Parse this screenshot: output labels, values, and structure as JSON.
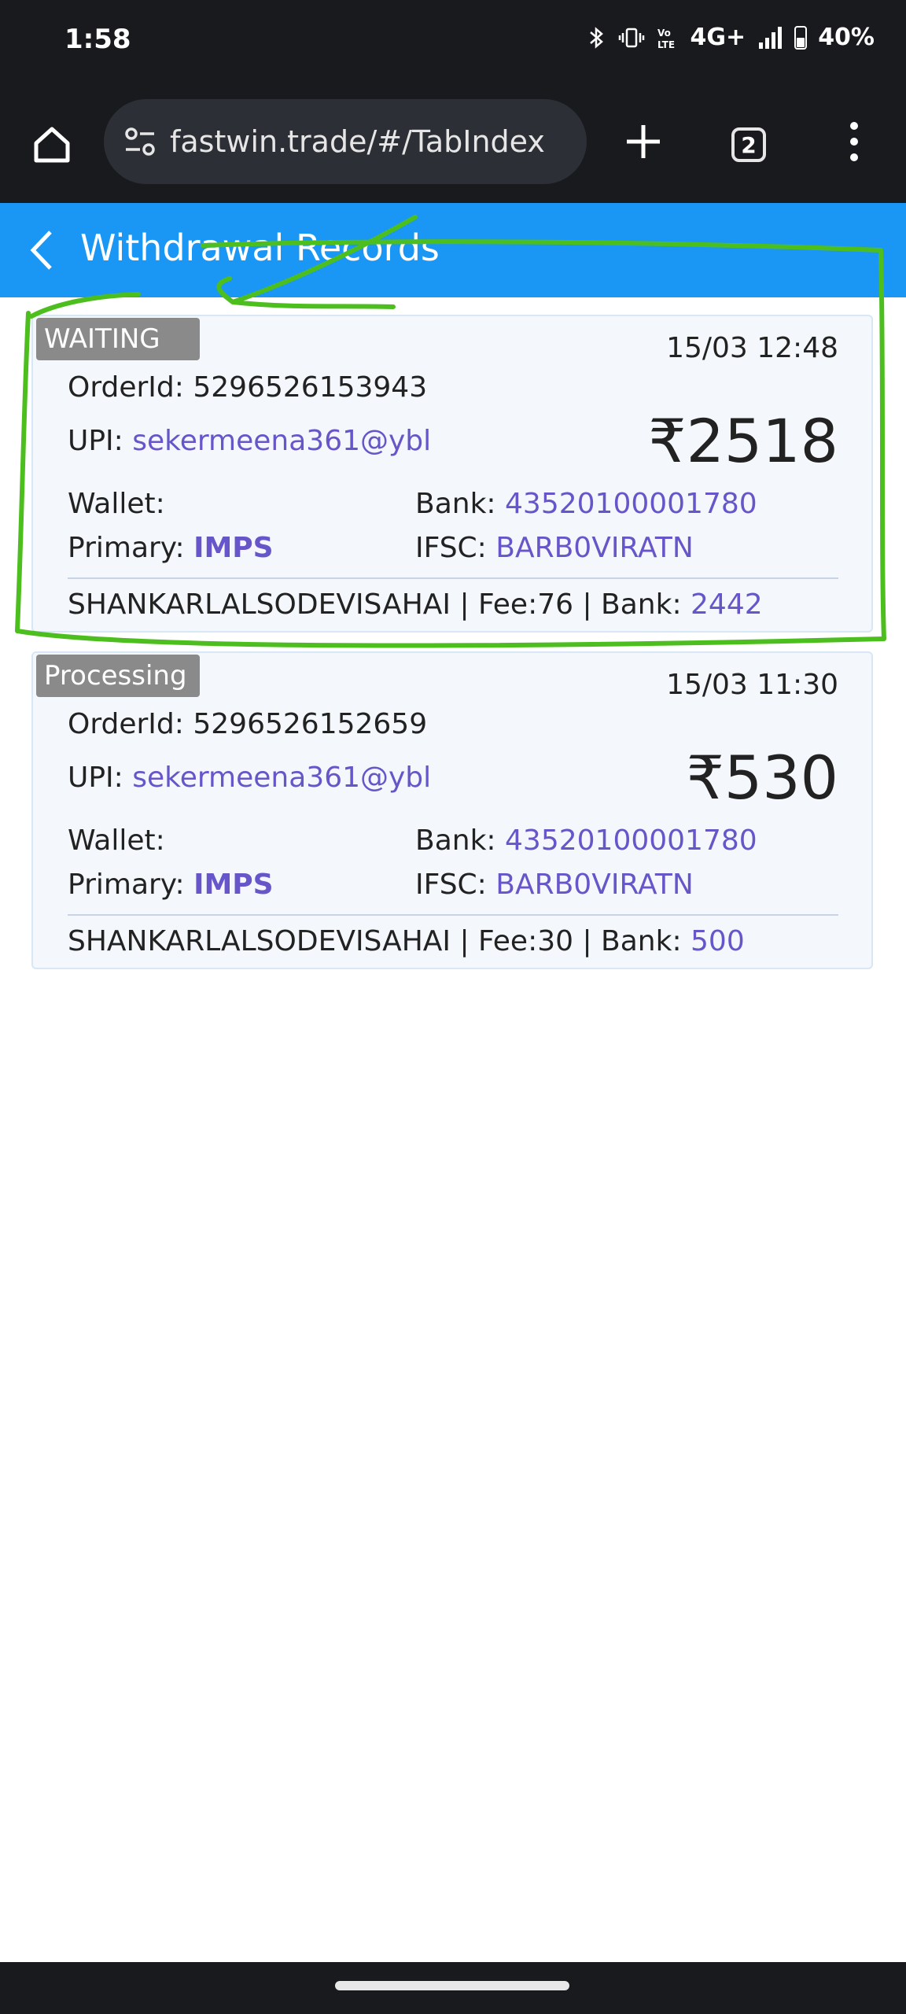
{
  "status_bar": {
    "time": "1:58",
    "network": "4G+",
    "battery": "40%"
  },
  "browser": {
    "url": "fastwin.trade/#/TabIndex",
    "tab_count": "2"
  },
  "header": {
    "title": "Withdrawal Records"
  },
  "records": [
    {
      "status": "WAITING",
      "datetime": "15/03 12:48",
      "order_label": "OrderId:",
      "order_id": "5296526153943",
      "upi_label": "UPI:",
      "upi": "sekermeena361@ybl",
      "amount": "₹2518",
      "wallet_label": "Wallet:",
      "bank_label": "Bank:",
      "bank_account": "43520100001780",
      "primary_label": "Primary:",
      "primary": "IMPS",
      "ifsc_label": "IFSC:",
      "ifsc": "BARB0VIRATN",
      "footer_text": "SHANKARLALSODEVISAHAI | Fee:76 | Bank: ",
      "footer_bank": "2442"
    },
    {
      "status": "Processing",
      "datetime": "15/03 11:30",
      "order_label": "OrderId:",
      "order_id": "5296526152659",
      "upi_label": "UPI:",
      "upi": "sekermeena361@ybl",
      "amount": "₹530",
      "wallet_label": "Wallet:",
      "bank_label": "Bank:",
      "bank_account": "43520100001780",
      "primary_label": "Primary:",
      "primary": "IMPS",
      "ifsc_label": "IFSC:",
      "ifsc": "BARB0VIRATN",
      "footer_text": "SHANKARLALSODEVISAHAI | Fee:30 | Bank: ",
      "footer_bank": "500"
    }
  ],
  "colors": {
    "header": "#1a97f5",
    "link": "#6656c9",
    "annotation": "#4cbf1f",
    "badge": "#8a8a8a"
  }
}
